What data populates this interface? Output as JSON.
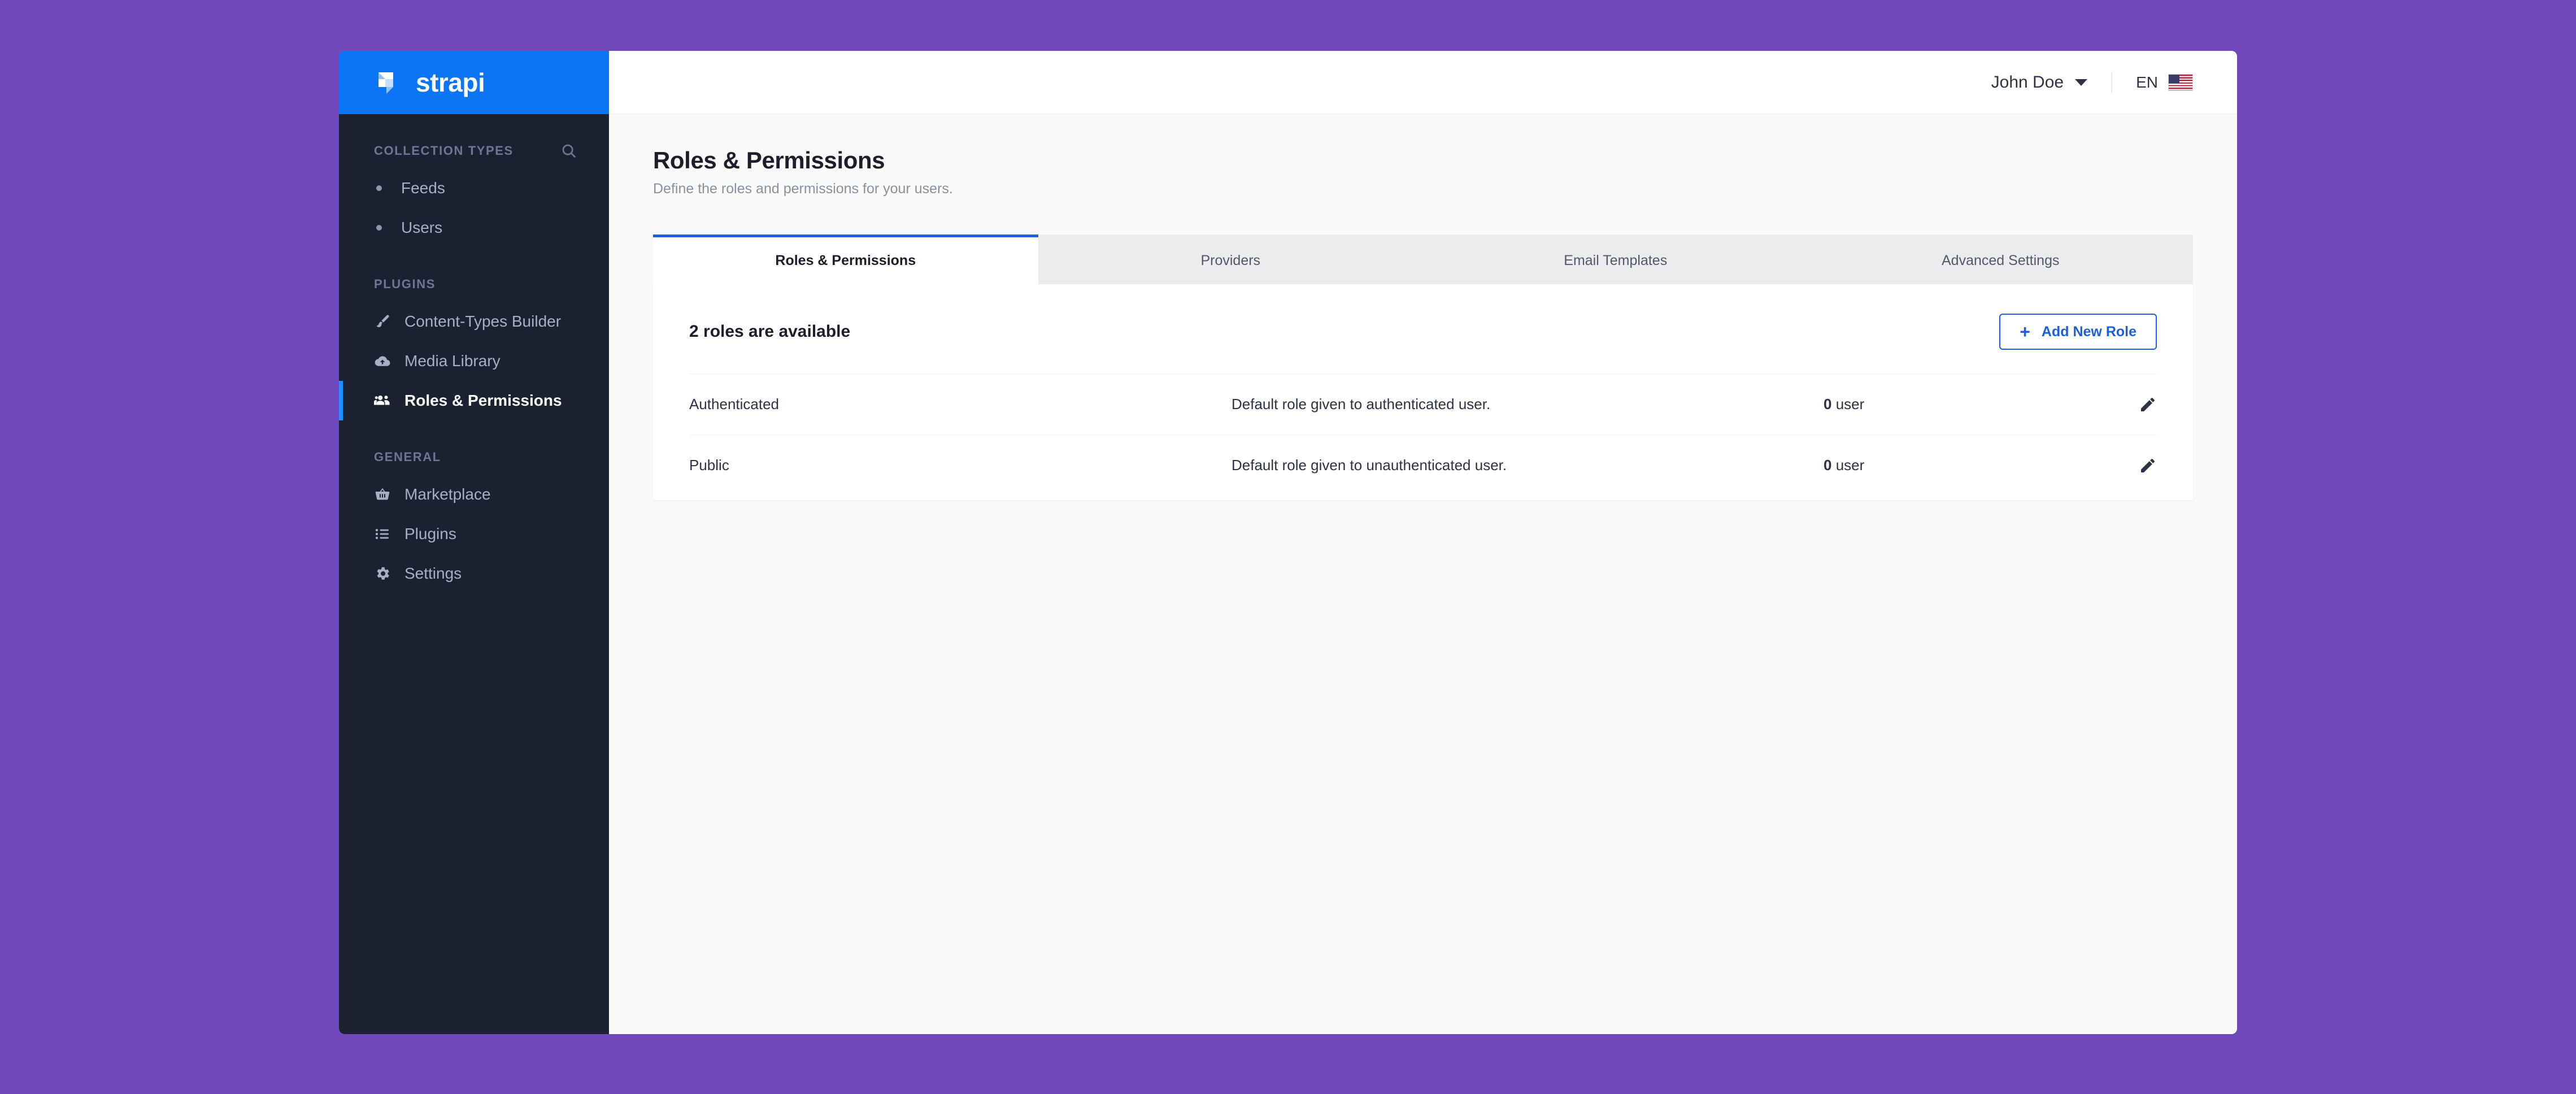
{
  "brand": {
    "name": "strapi",
    "logo_icon": "strapi-logo-icon",
    "color": "#0c75f5"
  },
  "sidebar": {
    "sections": [
      {
        "title": "COLLECTION TYPES",
        "has_search": true,
        "search_icon": "search-icon",
        "items": [
          {
            "label": "Feeds",
            "icon": "bullet-icon",
            "active": false
          },
          {
            "label": "Users",
            "icon": "bullet-icon",
            "active": false
          }
        ]
      },
      {
        "title": "PLUGINS",
        "has_search": false,
        "items": [
          {
            "label": "Content-Types Builder",
            "icon": "paintbrush-icon",
            "active": false
          },
          {
            "label": "Media Library",
            "icon": "cloud-upload-icon",
            "active": false
          },
          {
            "label": "Roles & Permissions",
            "icon": "users-group-icon",
            "active": true
          }
        ]
      },
      {
        "title": "GENERAL",
        "has_search": false,
        "items": [
          {
            "label": "Marketplace",
            "icon": "shopping-basket-icon",
            "active": false
          },
          {
            "label": "Plugins",
            "icon": "list-icon",
            "active": false
          },
          {
            "label": "Settings",
            "icon": "gear-icon",
            "active": false
          }
        ]
      }
    ]
  },
  "topbar": {
    "user_name": "John Doe",
    "caret_icon": "chevron-down-icon",
    "language": "EN",
    "flag_icon": "us-flag-icon"
  },
  "header": {
    "title": "Roles & Permissions",
    "subtitle": "Define the roles and permissions for your users."
  },
  "tabs": [
    {
      "label": "Roles & Permissions",
      "active": true
    },
    {
      "label": "Providers",
      "active": false
    },
    {
      "label": "Email Templates",
      "active": false
    },
    {
      "label": "Advanced Settings",
      "active": false
    }
  ],
  "panel": {
    "count_label": "2 roles are available",
    "add_button": {
      "label": "Add New Role",
      "icon": "plus-icon"
    },
    "rows": [
      {
        "name": "Authenticated",
        "description": "Default role given to authenticated user.",
        "users_count": "0",
        "users_unit": "user",
        "edit_icon": "pencil-icon"
      },
      {
        "name": "Public",
        "description": "Default role given to unauthenticated user.",
        "users_count": "0",
        "users_unit": "user",
        "edit_icon": "pencil-icon"
      }
    ]
  },
  "colors": {
    "page_background": "#7049bc",
    "brand_blue": "#0c75f5",
    "sidebar_dark": "#1c2132",
    "accent_blue": "#1e5ee0",
    "active_indicator": "#1e8fff"
  }
}
